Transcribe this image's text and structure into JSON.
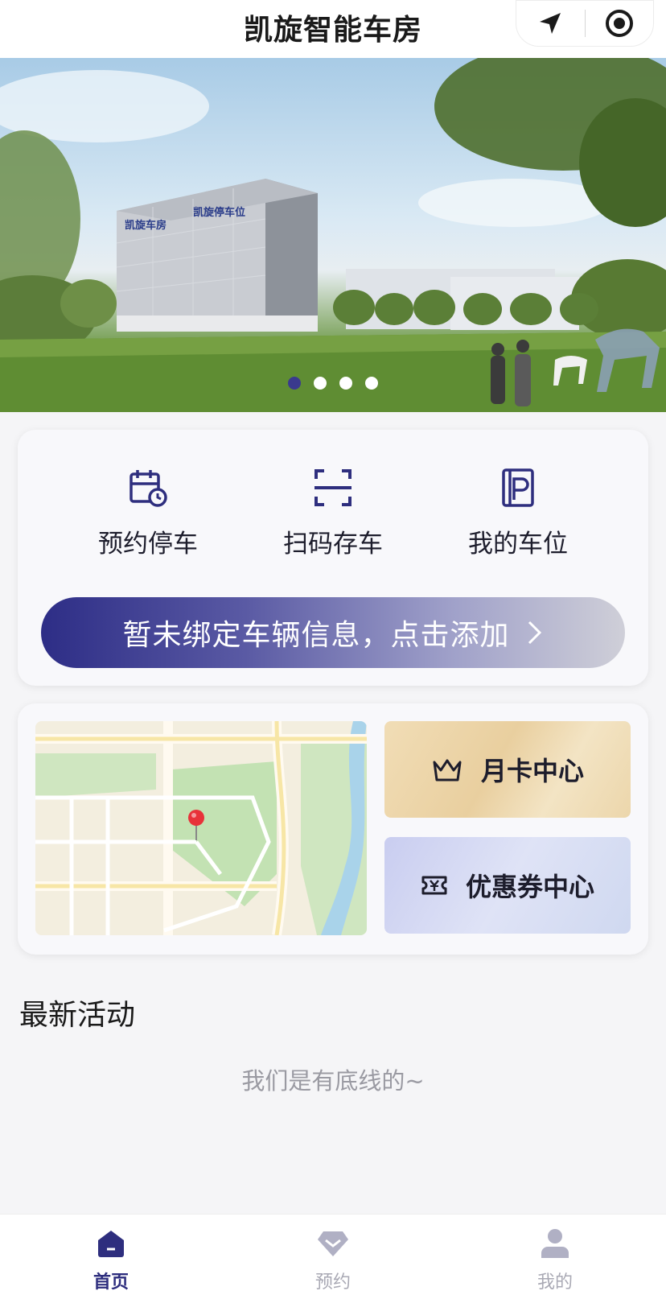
{
  "header": {
    "title": "凯旋智能车房",
    "location_icon": "location-arrow-icon",
    "close_icon": "target-circle-icon"
  },
  "banner": {
    "slide_count": 4,
    "active_index": 0,
    "building_sign_left": "凯旋车房",
    "building_sign_right": "凯旋停车位"
  },
  "quick_actions": [
    {
      "label": "预约停车",
      "icon": "calendar-clock-icon"
    },
    {
      "label": "扫码存车",
      "icon": "scan-icon"
    },
    {
      "label": "我的车位",
      "icon": "parking-flag-icon"
    }
  ],
  "bind_vehicle": {
    "label": "暂未绑定车辆信息，点击添加"
  },
  "services": {
    "month_card": {
      "label": "月卡中心",
      "icon": "crown-icon"
    },
    "coupon": {
      "label": "优惠券中心",
      "icon": "yen-ticket-icon"
    }
  },
  "latest": {
    "title": "最新活动",
    "empty_tip": "我们是有底线的~"
  },
  "tabbar": {
    "items": [
      {
        "label": "首页",
        "icon": "home-icon",
        "active": true
      },
      {
        "label": "预约",
        "icon": "diamond-icon",
        "active": false
      },
      {
        "label": "我的",
        "icon": "user-icon",
        "active": false
      }
    ]
  },
  "colors": {
    "primary": "#2e2e7e",
    "inactive": "#a9a9b4",
    "page_bg": "#f5f5f7"
  }
}
